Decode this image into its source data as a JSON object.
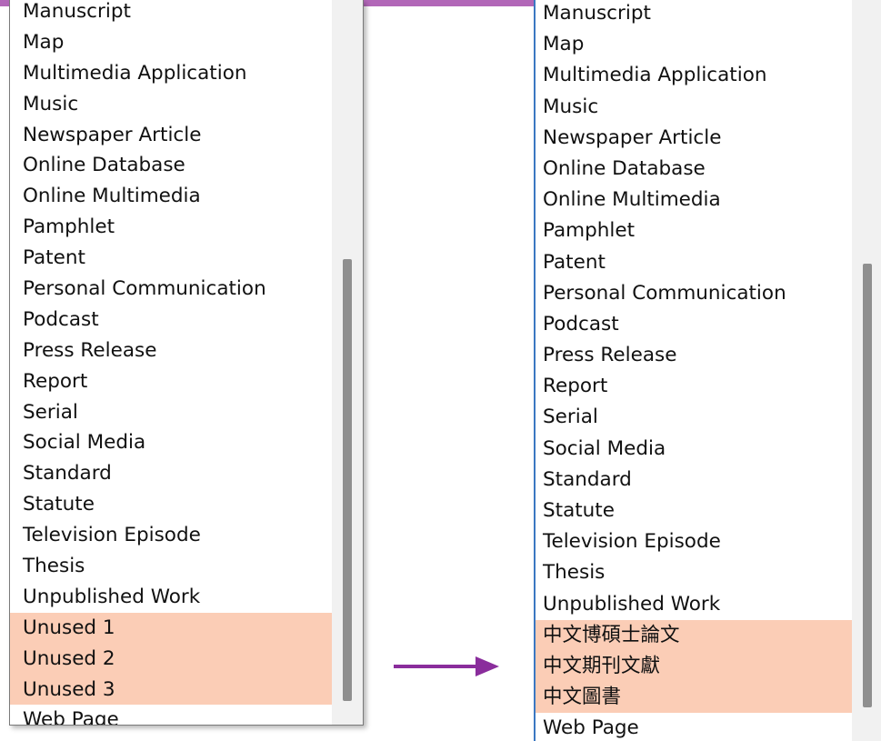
{
  "colors": {
    "top_band": "#b267b8",
    "highlight": "#fbcdb6",
    "arrow": "#8a2d9c",
    "focus_border": "#3b78c2"
  },
  "before_list": {
    "items": [
      "Manuscript",
      "Map",
      "Multimedia Application",
      "Music",
      "Newspaper Article",
      "Online Database",
      "Online Multimedia",
      "Pamphlet",
      "Patent",
      "Personal Communication",
      "Podcast",
      "Press Release",
      "Report",
      "Serial",
      "Social Media",
      "Standard",
      "Statute",
      "Television Episode",
      "Thesis",
      "Unpublished Work",
      "Unused 1",
      "Unused 2",
      "Unused 3",
      "Web Page"
    ],
    "highlighted": [
      "Unused 1",
      "Unused 2",
      "Unused 3"
    ]
  },
  "after_list": {
    "items": [
      "Manuscript",
      "Map",
      "Multimedia Application",
      "Music",
      "Newspaper Article",
      "Online Database",
      "Online Multimedia",
      "Pamphlet",
      "Patent",
      "Personal Communication",
      "Podcast",
      "Press Release",
      "Report",
      "Serial",
      "Social Media",
      "Standard",
      "Statute",
      "Television Episode",
      "Thesis",
      "Unpublished Work",
      "中文博碩士論文",
      "中文期刊文獻",
      "中文圖書",
      "Web Page"
    ],
    "highlighted": [
      "中文博碩士論文",
      "中文期刊文獻",
      "中文圖書"
    ]
  },
  "arrow_icon": "right-arrow-icon"
}
